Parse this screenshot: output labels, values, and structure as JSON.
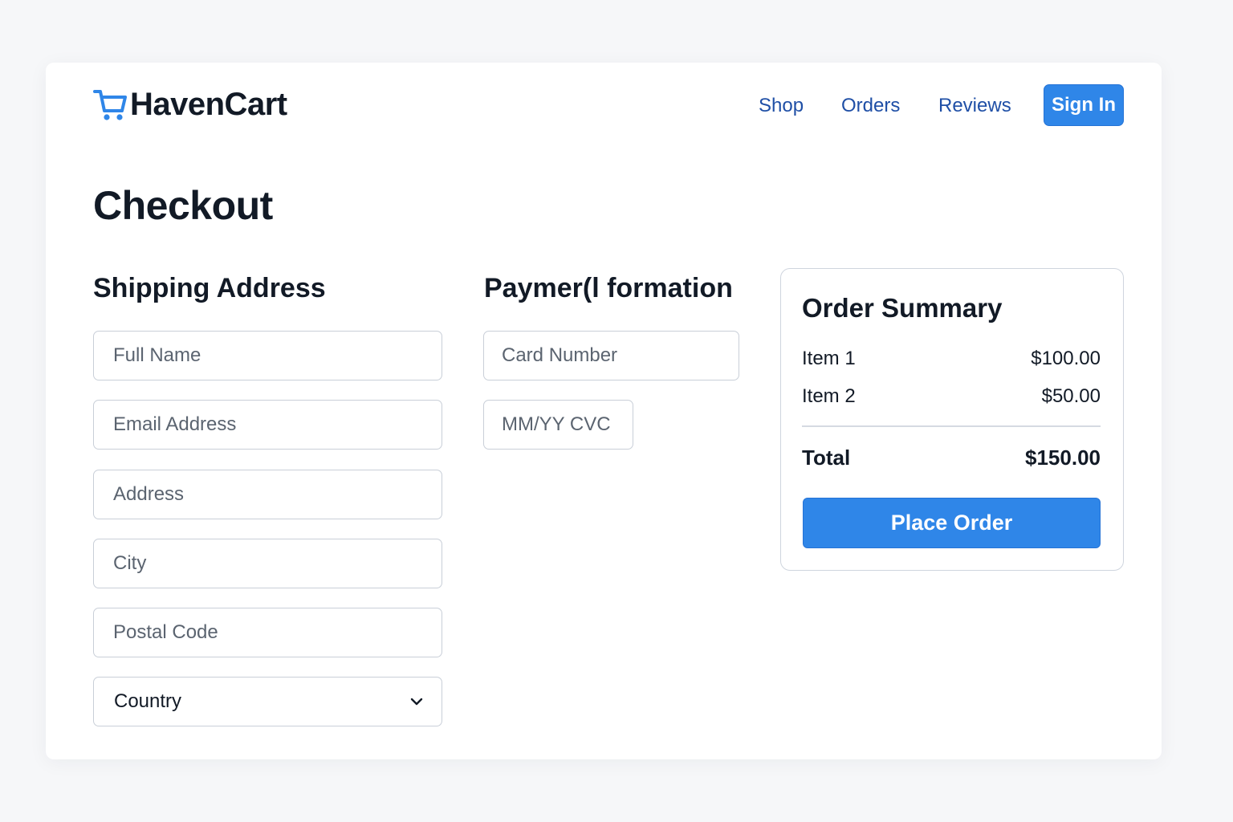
{
  "header": {
    "brand": "HavenCart",
    "logo_icon": "shopping-cart-icon",
    "nav": [
      {
        "label": "Shop"
      },
      {
        "label": "Orders"
      },
      {
        "label": "Reviews"
      }
    ],
    "signin_label": "Sign In"
  },
  "page": {
    "title": "Checkout"
  },
  "shipping": {
    "title": "Shipping Address",
    "fields": [
      {
        "placeholder": "Full Name",
        "value": ""
      },
      {
        "placeholder": "Email Address",
        "value": ""
      },
      {
        "placeholder": "Address",
        "value": ""
      },
      {
        "placeholder": "City",
        "value": ""
      },
      {
        "placeholder": "Postal Code",
        "value": ""
      }
    ],
    "country": {
      "value": "Country",
      "icon": "chevron-down-icon"
    }
  },
  "payment": {
    "title": "Paymer(l formation",
    "fields": [
      {
        "placeholder": "Card Number",
        "value": ""
      },
      {
        "placeholder": "MM/YY CVC",
        "value": ""
      }
    ]
  },
  "summary": {
    "title": "Order Summary",
    "items": [
      {
        "name": "Item 1",
        "price": "$100.00"
      },
      {
        "name": "Item 2",
        "price": "$50.00"
      }
    ],
    "total_label": "Total",
    "total_value": "$150.00",
    "button_label": "Place Order"
  },
  "colors": {
    "accent": "#2f86e8",
    "nav_link": "#1f4fa6",
    "text": "#121a26",
    "background": "#f6f7f9"
  }
}
